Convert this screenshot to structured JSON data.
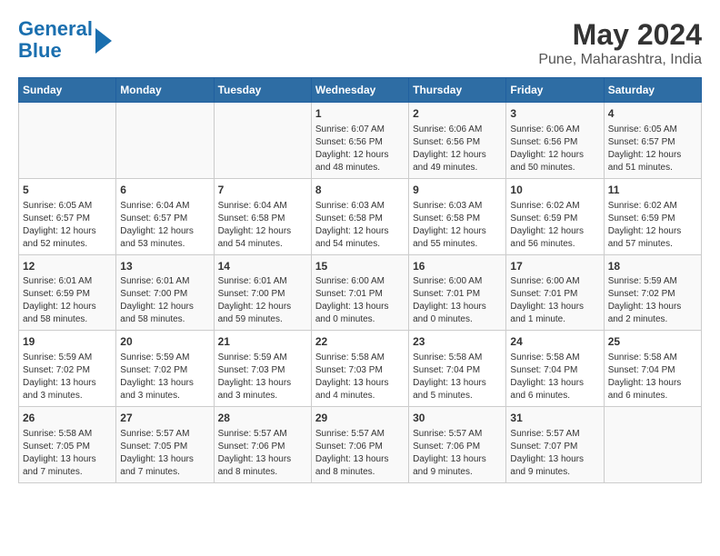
{
  "logo": {
    "line1": "General",
    "line2": "Blue"
  },
  "title": "May 2024",
  "subtitle": "Pune, Maharashtra, India",
  "days_of_week": [
    "Sunday",
    "Monday",
    "Tuesday",
    "Wednesday",
    "Thursday",
    "Friday",
    "Saturday"
  ],
  "weeks": [
    [
      {
        "day": "",
        "info": ""
      },
      {
        "day": "",
        "info": ""
      },
      {
        "day": "",
        "info": ""
      },
      {
        "day": "1",
        "info": "Sunrise: 6:07 AM\nSunset: 6:56 PM\nDaylight: 12 hours\nand 48 minutes."
      },
      {
        "day": "2",
        "info": "Sunrise: 6:06 AM\nSunset: 6:56 PM\nDaylight: 12 hours\nand 49 minutes."
      },
      {
        "day": "3",
        "info": "Sunrise: 6:06 AM\nSunset: 6:56 PM\nDaylight: 12 hours\nand 50 minutes."
      },
      {
        "day": "4",
        "info": "Sunrise: 6:05 AM\nSunset: 6:57 PM\nDaylight: 12 hours\nand 51 minutes."
      }
    ],
    [
      {
        "day": "5",
        "info": "Sunrise: 6:05 AM\nSunset: 6:57 PM\nDaylight: 12 hours\nand 52 minutes."
      },
      {
        "day": "6",
        "info": "Sunrise: 6:04 AM\nSunset: 6:57 PM\nDaylight: 12 hours\nand 53 minutes."
      },
      {
        "day": "7",
        "info": "Sunrise: 6:04 AM\nSunset: 6:58 PM\nDaylight: 12 hours\nand 54 minutes."
      },
      {
        "day": "8",
        "info": "Sunrise: 6:03 AM\nSunset: 6:58 PM\nDaylight: 12 hours\nand 54 minutes."
      },
      {
        "day": "9",
        "info": "Sunrise: 6:03 AM\nSunset: 6:58 PM\nDaylight: 12 hours\nand 55 minutes."
      },
      {
        "day": "10",
        "info": "Sunrise: 6:02 AM\nSunset: 6:59 PM\nDaylight: 12 hours\nand 56 minutes."
      },
      {
        "day": "11",
        "info": "Sunrise: 6:02 AM\nSunset: 6:59 PM\nDaylight: 12 hours\nand 57 minutes."
      }
    ],
    [
      {
        "day": "12",
        "info": "Sunrise: 6:01 AM\nSunset: 6:59 PM\nDaylight: 12 hours\nand 58 minutes."
      },
      {
        "day": "13",
        "info": "Sunrise: 6:01 AM\nSunset: 7:00 PM\nDaylight: 12 hours\nand 58 minutes."
      },
      {
        "day": "14",
        "info": "Sunrise: 6:01 AM\nSunset: 7:00 PM\nDaylight: 12 hours\nand 59 minutes."
      },
      {
        "day": "15",
        "info": "Sunrise: 6:00 AM\nSunset: 7:01 PM\nDaylight: 13 hours\nand 0 minutes."
      },
      {
        "day": "16",
        "info": "Sunrise: 6:00 AM\nSunset: 7:01 PM\nDaylight: 13 hours\nand 0 minutes."
      },
      {
        "day": "17",
        "info": "Sunrise: 6:00 AM\nSunset: 7:01 PM\nDaylight: 13 hours\nand 1 minute."
      },
      {
        "day": "18",
        "info": "Sunrise: 5:59 AM\nSunset: 7:02 PM\nDaylight: 13 hours\nand 2 minutes."
      }
    ],
    [
      {
        "day": "19",
        "info": "Sunrise: 5:59 AM\nSunset: 7:02 PM\nDaylight: 13 hours\nand 3 minutes."
      },
      {
        "day": "20",
        "info": "Sunrise: 5:59 AM\nSunset: 7:02 PM\nDaylight: 13 hours\nand 3 minutes."
      },
      {
        "day": "21",
        "info": "Sunrise: 5:59 AM\nSunset: 7:03 PM\nDaylight: 13 hours\nand 3 minutes."
      },
      {
        "day": "22",
        "info": "Sunrise: 5:58 AM\nSunset: 7:03 PM\nDaylight: 13 hours\nand 4 minutes."
      },
      {
        "day": "23",
        "info": "Sunrise: 5:58 AM\nSunset: 7:04 PM\nDaylight: 13 hours\nand 5 minutes."
      },
      {
        "day": "24",
        "info": "Sunrise: 5:58 AM\nSunset: 7:04 PM\nDaylight: 13 hours\nand 6 minutes."
      },
      {
        "day": "25",
        "info": "Sunrise: 5:58 AM\nSunset: 7:04 PM\nDaylight: 13 hours\nand 6 minutes."
      }
    ],
    [
      {
        "day": "26",
        "info": "Sunrise: 5:58 AM\nSunset: 7:05 PM\nDaylight: 13 hours\nand 7 minutes."
      },
      {
        "day": "27",
        "info": "Sunrise: 5:57 AM\nSunset: 7:05 PM\nDaylight: 13 hours\nand 7 minutes."
      },
      {
        "day": "28",
        "info": "Sunrise: 5:57 AM\nSunset: 7:06 PM\nDaylight: 13 hours\nand 8 minutes."
      },
      {
        "day": "29",
        "info": "Sunrise: 5:57 AM\nSunset: 7:06 PM\nDaylight: 13 hours\nand 8 minutes."
      },
      {
        "day": "30",
        "info": "Sunrise: 5:57 AM\nSunset: 7:06 PM\nDaylight: 13 hours\nand 9 minutes."
      },
      {
        "day": "31",
        "info": "Sunrise: 5:57 AM\nSunset: 7:07 PM\nDaylight: 13 hours\nand 9 minutes."
      },
      {
        "day": "",
        "info": ""
      }
    ]
  ]
}
